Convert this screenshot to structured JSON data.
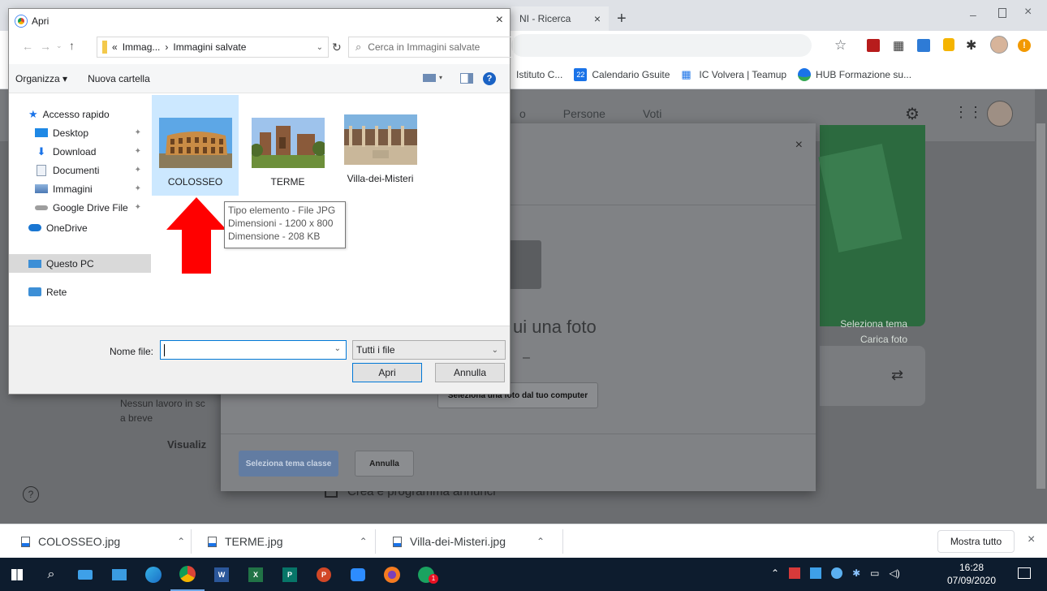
{
  "browser": {
    "tabs": [
      {
        "label": "NI - Ricerca"
      }
    ],
    "new_tab": "+",
    "bookmarks": [
      {
        "label": "Istituto C..."
      },
      {
        "label": "Calendario Gsuite"
      },
      {
        "label": "IC Volvera | Teamup"
      },
      {
        "label": "HUB Formazione su..."
      }
    ],
    "calendar_badge": "22"
  },
  "classroom": {
    "tabs": [
      "o",
      "Persone",
      "Voti"
    ],
    "banner": {
      "select_theme": "Seleziona tema",
      "upload_photo": "Carica foto"
    },
    "card_left": {
      "text": "Nessun lavoro in sc",
      "text2": "a breve",
      "view": "Visualiz"
    },
    "announce": "Crea e programma annunci",
    "help": "?"
  },
  "modal": {
    "close": "×",
    "drag_text": "ui una foto",
    "drag_dash": "–",
    "pick_button": "Seleziona una foto dal tuo computer",
    "select_theme_button": "Seleziona tema classe",
    "cancel_button": "Annulla"
  },
  "dialog": {
    "title": "Apri",
    "path": [
      "«",
      "Immag...",
      "›",
      "Immagini salvate"
    ],
    "search_placeholder": "Cerca in Immagini salvate",
    "organize": "Organizza ▾",
    "new_folder": "Nuova cartella",
    "nav": [
      {
        "label": "Accesso rapido",
        "icon": "star-icon"
      },
      {
        "label": "Desktop",
        "icon": "desktop-icon",
        "pinned": true
      },
      {
        "label": "Download",
        "icon": "download-icon",
        "pinned": true
      },
      {
        "label": "Documenti",
        "icon": "documents-icon",
        "pinned": true
      },
      {
        "label": "Immagini",
        "icon": "images-icon",
        "pinned": true
      },
      {
        "label": "Google Drive File",
        "icon": "drive-icon",
        "pinned": true
      },
      {
        "label": "OneDrive",
        "icon": "onedrive-icon"
      },
      {
        "label": "Questo PC",
        "icon": "pc-icon",
        "selected": true
      },
      {
        "label": "Rete",
        "icon": "network-icon"
      }
    ],
    "files": [
      {
        "name": "COLOSSEO",
        "selected": true
      },
      {
        "name": "TERME"
      },
      {
        "name": "Villa-dei-Misteri"
      }
    ],
    "tooltip": [
      "Tipo elemento - File JPG",
      "Dimensioni - 1200 x 800",
      "Dimensione - 208 KB"
    ],
    "filename_label": "Nome file:",
    "filename_value": "",
    "filetype": "Tutti i file",
    "open_button": "Apri",
    "cancel_button": "Annulla"
  },
  "downloads": {
    "items": [
      {
        "name": "COLOSSEO.jpg"
      },
      {
        "name": "TERME.jpg"
      },
      {
        "name": "Villa-dei-Misteri.jpg"
      }
    ],
    "show_all": "Mostra tutto",
    "close": "×"
  },
  "taskbar": {
    "time": "16:28",
    "date": "07/09/2020",
    "badge": "1"
  },
  "colors": {
    "accent": "#0078d7",
    "arrow": "#ff0000",
    "banner": "#2c6a3f"
  }
}
